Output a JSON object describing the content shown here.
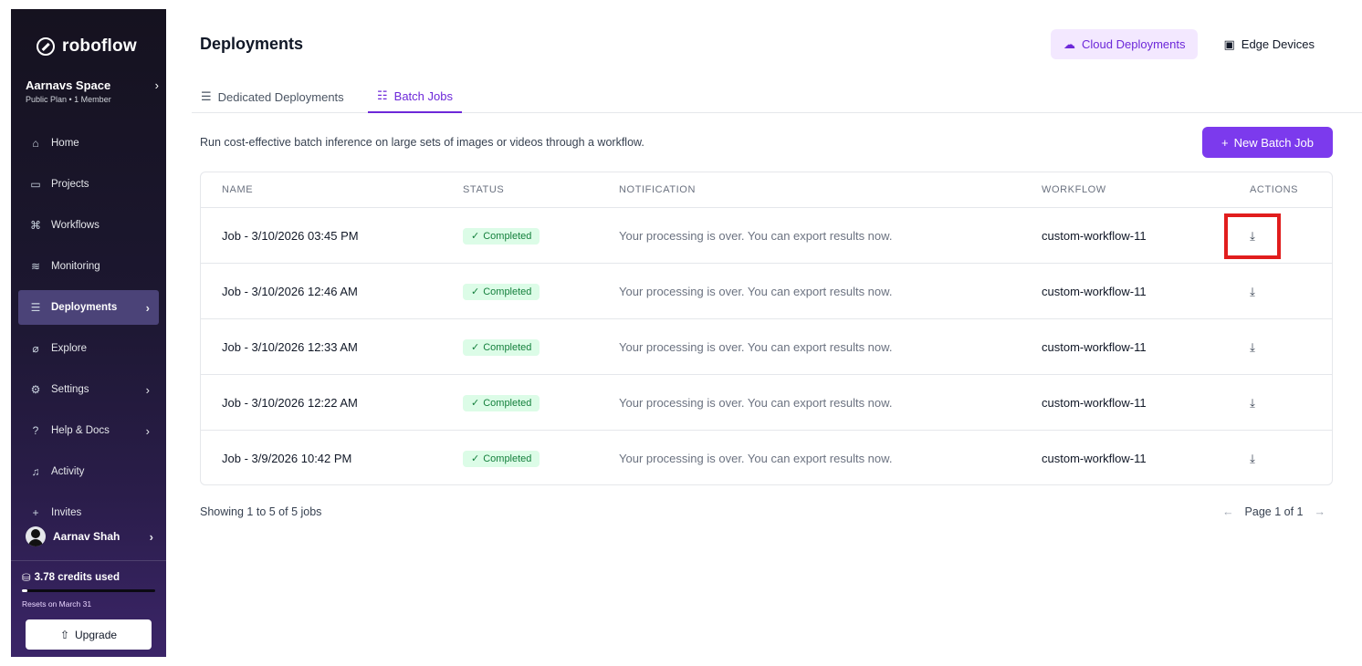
{
  "sidebar": {
    "logo": "roboflow",
    "workspace": {
      "name": "Aarnavs Space",
      "plan": "Public Plan • 1 Member"
    },
    "items": [
      {
        "label": "Home",
        "icon": "home-icon",
        "chevron": false
      },
      {
        "label": "Projects",
        "icon": "projects-icon",
        "chevron": false
      },
      {
        "label": "Workflows",
        "icon": "workflows-icon",
        "chevron": false
      },
      {
        "label": "Monitoring",
        "icon": "monitoring-icon",
        "chevron": false
      },
      {
        "label": "Deployments",
        "icon": "deployments-icon",
        "chevron": true,
        "active": true
      },
      {
        "label": "Explore",
        "icon": "explore-icon",
        "chevron": false
      },
      {
        "label": "Settings",
        "icon": "settings-icon",
        "chevron": true
      },
      {
        "label": "Help & Docs",
        "icon": "help-icon",
        "chevron": true
      },
      {
        "label": "Activity",
        "icon": "bell-icon",
        "chevron": false
      },
      {
        "label": "Invites",
        "icon": "add-user-icon",
        "chevron": false
      }
    ],
    "user": "Aarnav Shah",
    "credits": "3.78 credits used",
    "credits_fraction": 0.04,
    "resets": "Resets on March 31",
    "upgrade": "Upgrade"
  },
  "header": {
    "title": "Deployments",
    "cloud_btn": "Cloud Deployments",
    "edge_btn": "Edge Devices"
  },
  "tabs": [
    {
      "label": "Dedicated Deployments"
    },
    {
      "label": "Batch Jobs",
      "active": true
    }
  ],
  "description": "Run cost-effective batch inference on large sets of images or videos through a workflow.",
  "new_batch_job": "New Batch Job",
  "table": {
    "columns": [
      "NAME",
      "STATUS",
      "NOTIFICATION",
      "WORKFLOW",
      "ACTIONS"
    ],
    "rows": [
      {
        "name": "Job - 3/10/2026 03:45 PM",
        "status": "Completed",
        "notification": "Your processing is over. You can export results now.",
        "workflow": "custom-workflow-11"
      },
      {
        "name": "Job - 3/10/2026 12:46 AM",
        "status": "Completed",
        "notification": "Your processing is over. You can export results now.",
        "workflow": "custom-workflow-11"
      },
      {
        "name": "Job - 3/10/2026 12:33 AM",
        "status": "Completed",
        "notification": "Your processing is over. You can export results now.",
        "workflow": "custom-workflow-11"
      },
      {
        "name": "Job - 3/10/2026 12:22 AM",
        "status": "Completed",
        "notification": "Your processing is over. You can export results now.",
        "workflow": "custom-workflow-11"
      },
      {
        "name": "Job - 3/9/2026 10:42 PM",
        "status": "Completed",
        "notification": "Your processing is over. You can export results now.",
        "workflow": "custom-workflow-11"
      }
    ]
  },
  "footer": {
    "showing": "Showing 1 to 5 of 5 jobs",
    "page": "Page 1 of 1"
  }
}
